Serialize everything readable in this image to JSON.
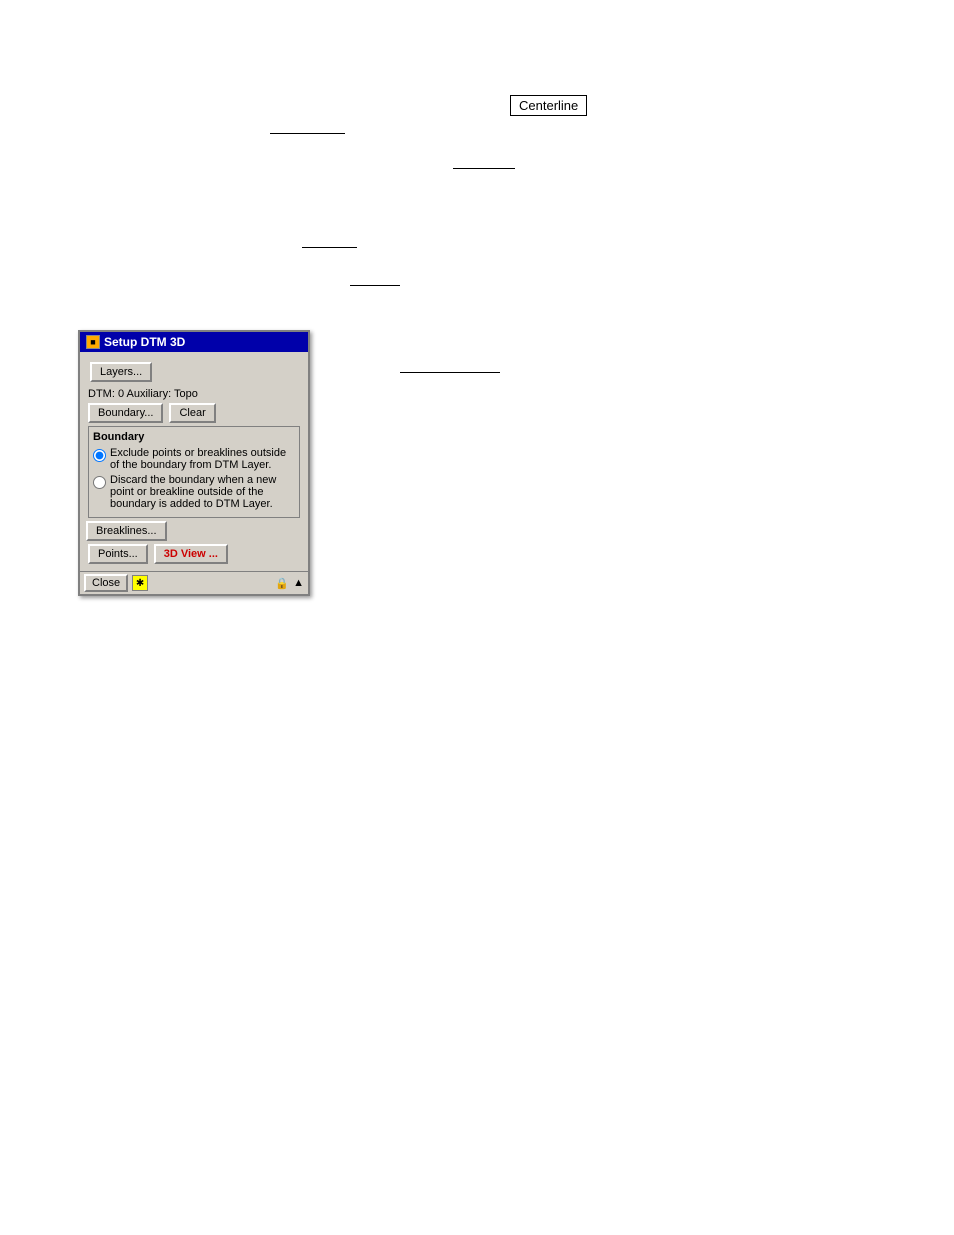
{
  "page": {
    "background": "#ffffff"
  },
  "centerline": {
    "label": "Centerline"
  },
  "dialog": {
    "title": "Setup DTM 3D",
    "layers_button": "Layers...",
    "dtm_label": "DTM: 0 Auxiliary: Topo",
    "boundary_button": "Boundary...",
    "clear_button": "Clear",
    "boundary_group_title": "Boundary",
    "radio1_label": "Exclude points or breaklines outside of the boundary from DTM Layer.",
    "radio2_label": "Discard the boundary when a new point or breakline outside of the boundary is added to DTM Layer.",
    "breaklines_button": "Breaklines...",
    "points_button": "Points...",
    "view3d_button": "3D View ...",
    "close_button": "Close"
  }
}
